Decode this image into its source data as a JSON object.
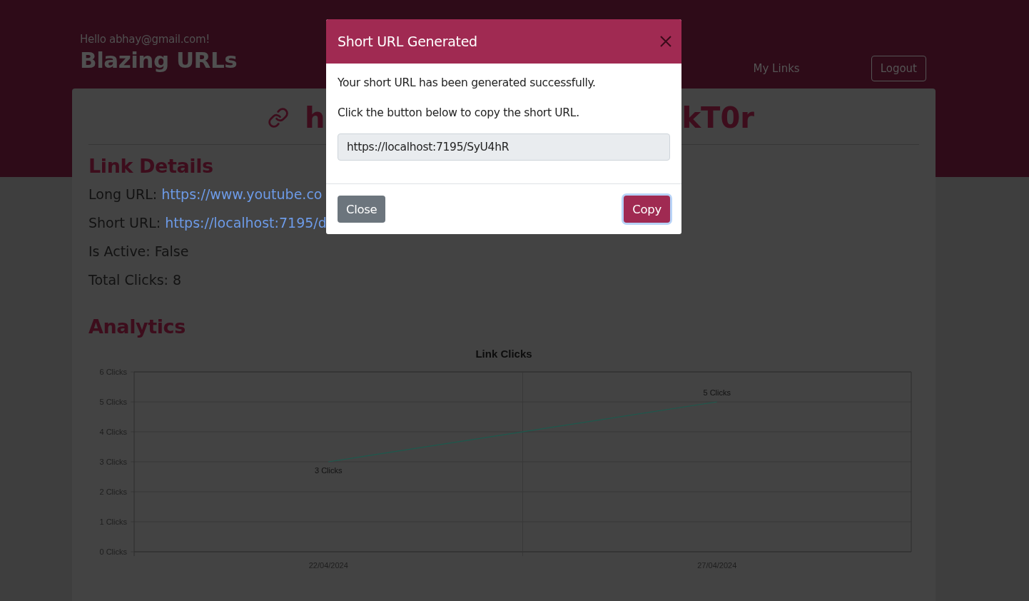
{
  "header": {
    "greeting": "Hello abhay@gmail.com!",
    "brand": "Blazing URLs",
    "nav": [
      {
        "label": "My Links",
        "kind": "link"
      },
      {
        "label": "Logout",
        "kind": "button"
      }
    ]
  },
  "card": {
    "title_start": "h",
    "title_end": "kT0r",
    "details_heading": "Link Details",
    "details": [
      {
        "label": "Long URL:",
        "value": "https://www.youtube.co",
        "kind": "link"
      },
      {
        "label": "Short URL:",
        "value": "https://localhost:7195/d",
        "kind": "link"
      },
      {
        "label": "Is Active:",
        "value": "False",
        "kind": "text"
      },
      {
        "label": "Total Clicks:",
        "value": "8",
        "kind": "text"
      }
    ],
    "analytics_heading": "Analytics",
    "chart_data": {
      "type": "line",
      "title": "Link Clicks",
      "categories": [
        "22/04/2024",
        "27/04/2024"
      ],
      "series": [
        {
          "color": "#1d5a4e",
          "values": [
            3,
            5
          ]
        }
      ],
      "ylim": [
        0,
        6
      ],
      "grid": true,
      "yticks": [
        {
          "value": 0,
          "label": "0 Clicks"
        },
        {
          "value": 1,
          "label": "1 Clicks"
        },
        {
          "value": 2,
          "label": "2 Clicks"
        },
        {
          "value": 3,
          "label": "3 Clicks"
        },
        {
          "value": 4,
          "label": "4 Clicks"
        },
        {
          "value": 5,
          "label": "5 Clicks"
        },
        {
          "value": 6,
          "label": "6 Clicks"
        }
      ],
      "value_labels": [
        "3 Clicks",
        "5 Clicks"
      ]
    }
  },
  "modal": {
    "title": "Short URL Generated",
    "message": "Your short URL has been generated successfully.",
    "instruction": "Click the button below to copy the short URL.",
    "url": "https://localhost:7195/SyU4hR",
    "buttons": [
      {
        "label": "Close",
        "kind": "secondary",
        "focused": false
      },
      {
        "label": "Copy",
        "kind": "primary",
        "focused": true
      }
    ]
  }
}
